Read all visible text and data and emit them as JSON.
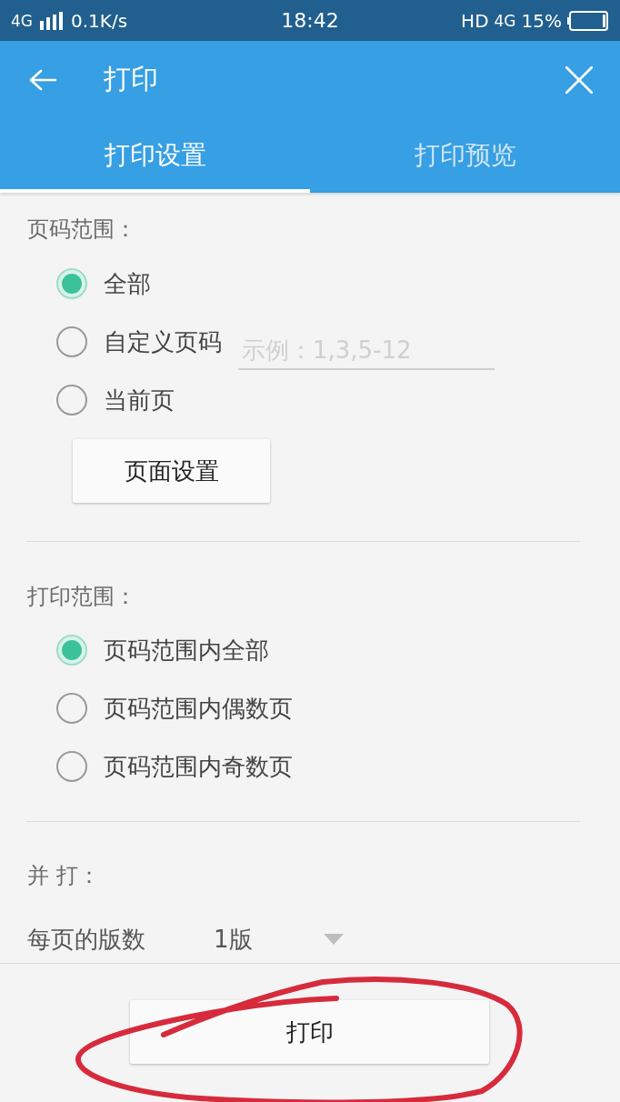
{
  "status_bar": {
    "network": "4G",
    "speed": "0.1K/s",
    "time": "18:42",
    "hd": "HD",
    "network_right": "4G",
    "battery": "15%"
  },
  "app_bar": {
    "title": "打印"
  },
  "tabs": [
    {
      "label": "打印设置",
      "selected": true
    },
    {
      "label": "打印预览",
      "selected": false
    }
  ],
  "sections": [
    {
      "title": "页码范围：",
      "options": [
        {
          "label": "全部",
          "selected": true
        },
        {
          "label": "自定义页码",
          "selected": false,
          "field": {
            "placeholder": "示例：1,3,5-12"
          }
        },
        {
          "label": "当前页",
          "selected": false
        }
      ],
      "button": "页面设置"
    },
    {
      "title": "打印范围：",
      "options": [
        {
          "label": "页码范围内全部",
          "selected": true
        },
        {
          "label": "页码范围内偶数页",
          "selected": false
        },
        {
          "label": "页码范围内奇数页",
          "selected": false
        }
      ]
    }
  ],
  "pages_per_sheet": {
    "title": "并 打：",
    "label": "每页的版数",
    "value": "1版"
  },
  "print_button": "打印"
}
